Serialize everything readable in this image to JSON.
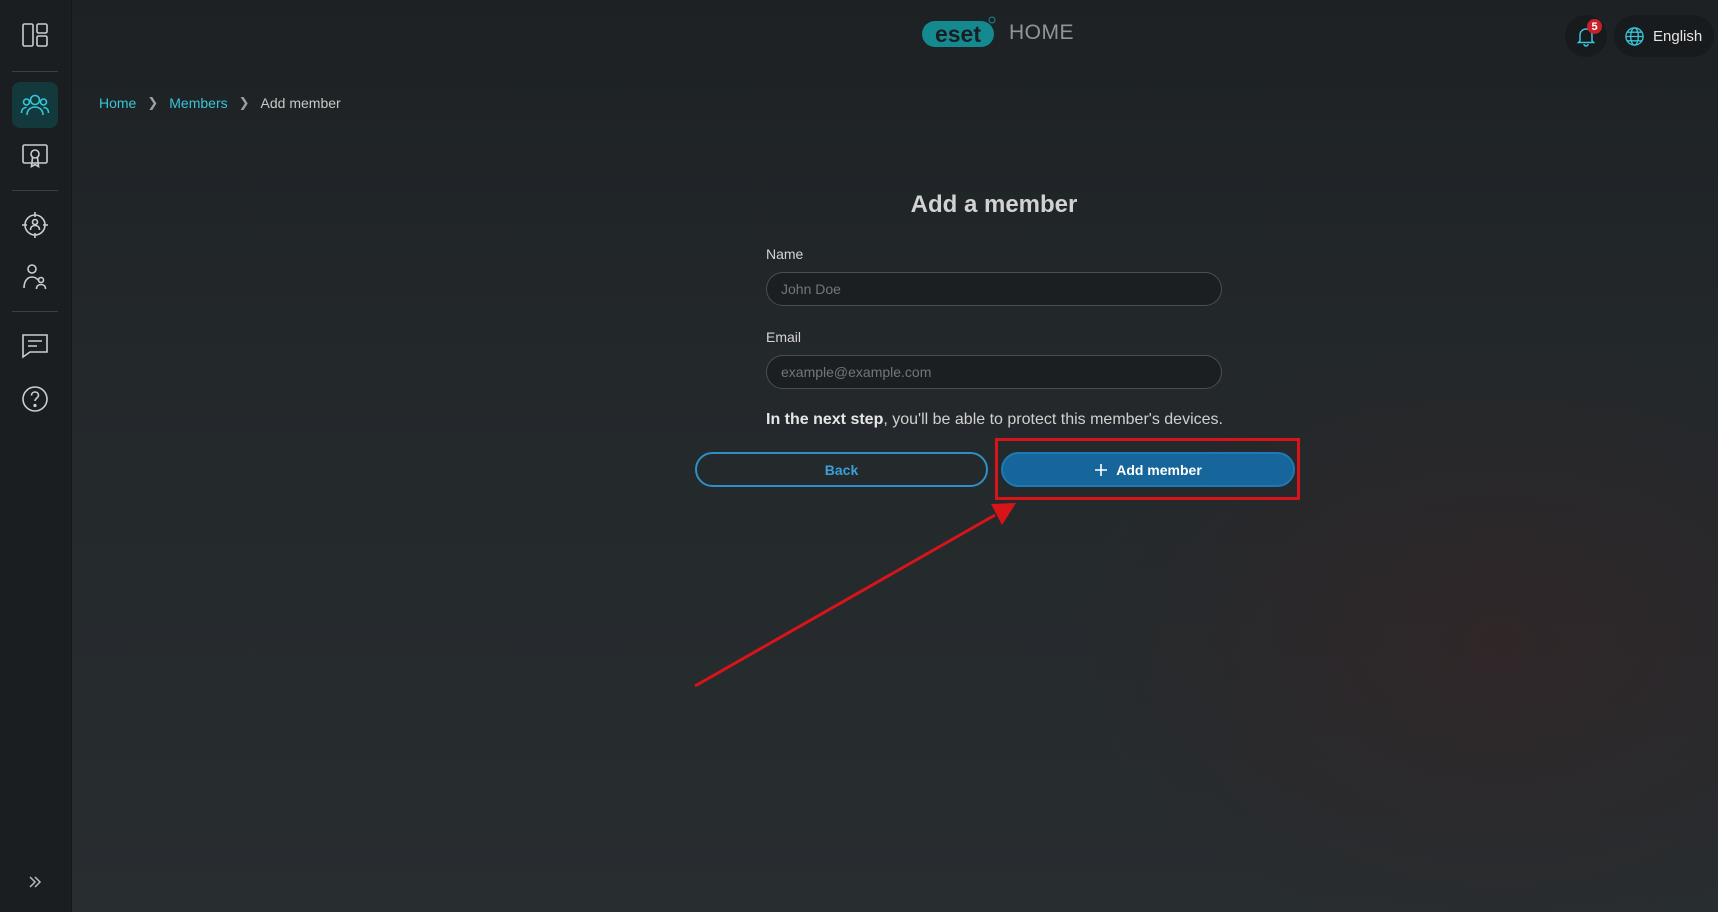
{
  "header": {
    "logo_text": "eset",
    "logo_suffix": "HOME",
    "notification_count": "5",
    "language": "English"
  },
  "sidebar": {
    "items": [
      {
        "icon": "dashboard-icon"
      },
      {
        "icon": "members-icon",
        "active": true
      },
      {
        "icon": "license-icon"
      },
      {
        "icon": "anti-theft-icon"
      },
      {
        "icon": "parental-control-icon"
      },
      {
        "icon": "feedback-icon"
      },
      {
        "icon": "help-icon"
      }
    ]
  },
  "breadcrumb": {
    "home": "Home",
    "members": "Members",
    "current": "Add member"
  },
  "form": {
    "title": "Add a member",
    "name_label": "Name",
    "name_placeholder": "John Doe",
    "email_label": "Email",
    "email_placeholder": "example@example.com",
    "info_bold": "In the next step",
    "info_rest": ", you'll be able to protect this member's devices.",
    "back_label": "Back",
    "add_label": "Add member"
  },
  "colors": {
    "accent": "#36c6d8",
    "primary_button": "#16669b",
    "annotation": "#d8141b"
  }
}
